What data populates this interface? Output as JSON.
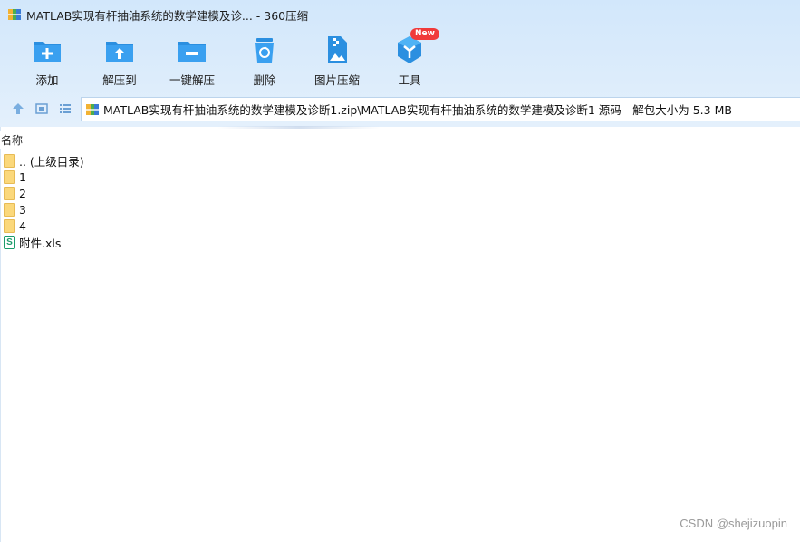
{
  "window": {
    "title": "MATLAB实现有杆抽油系统的数学建模及诊... - 360压缩"
  },
  "toolbar": {
    "items": [
      {
        "label": "添加",
        "icon": "folder-add-icon"
      },
      {
        "label": "解压到",
        "icon": "folder-extract-icon"
      },
      {
        "label": "一键解压",
        "icon": "folder-oneclick-icon"
      },
      {
        "label": "删除",
        "icon": "recycle-bin-icon"
      },
      {
        "label": "图片压缩",
        "icon": "image-zip-icon"
      },
      {
        "label": "工具",
        "icon": "tools-cube-icon"
      }
    ],
    "new_badge": "New"
  },
  "address": {
    "path": "MATLAB实现有杆抽油系统的数学建模及诊断1.zip\\MATLAB实现有杆抽油系统的数学建模及诊断1 源码 - 解包大小为 5.3 MB"
  },
  "list": {
    "column_name": "名称",
    "items": [
      {
        "name": ".. (上级目录)",
        "type": "folder"
      },
      {
        "name": "1",
        "type": "folder"
      },
      {
        "name": "2",
        "type": "folder"
      },
      {
        "name": "3",
        "type": "folder"
      },
      {
        "name": "4",
        "type": "folder"
      },
      {
        "name": "附件.xls",
        "type": "spreadsheet",
        "icon_letter": "S"
      }
    ]
  },
  "watermark": "CSDN @shejizuopin",
  "colors": {
    "accent": "#2b8fe0",
    "folder": "#fbd87b",
    "spreadsheet": "#1b9c6b",
    "badge": "#f03a3a"
  }
}
